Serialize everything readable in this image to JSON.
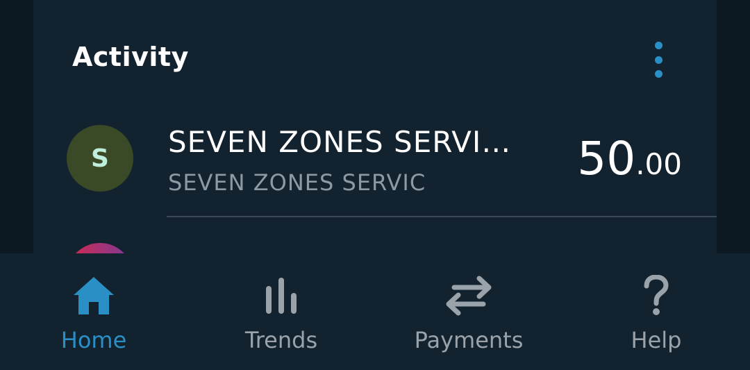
{
  "colors": {
    "accent": "#2a8fc4",
    "muted": "#9aa3aa",
    "avatar_bg": "#3b4a26",
    "avatar_fg": "#bfeedd"
  },
  "activity": {
    "title": "Activity",
    "menu_icon": "kebab-menu-icon"
  },
  "transactions": [
    {
      "avatar_letter": "S",
      "name": "SEVEN ZONES SERVI…",
      "subtitle": "SEVEN ZONES SERVIC",
      "amount_int": "50",
      "amount_dec": ".00"
    }
  ],
  "nav": {
    "items": [
      {
        "label": "Home",
        "icon": "home-icon",
        "active": true
      },
      {
        "label": "Trends",
        "icon": "bar-chart-icon",
        "active": false
      },
      {
        "label": "Payments",
        "icon": "transfer-arrows-icon",
        "active": false
      },
      {
        "label": "Help",
        "icon": "question-mark-icon",
        "active": false
      }
    ]
  }
}
